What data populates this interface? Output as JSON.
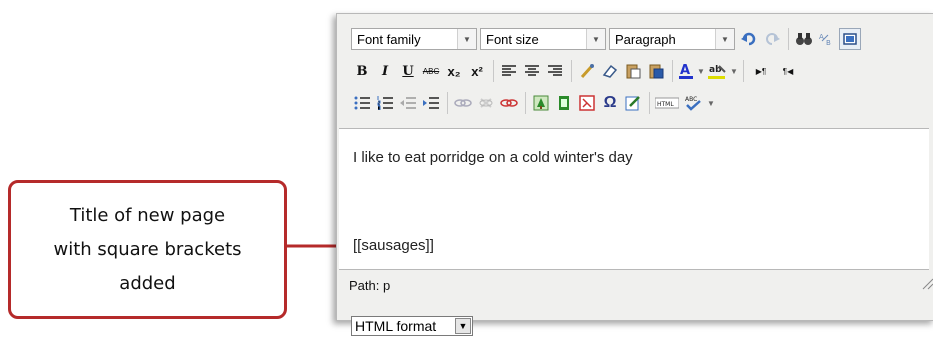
{
  "toolbar": {
    "font_family": "Font family",
    "font_size": "Font size",
    "paragraph": "Paragraph",
    "row2": [
      "B",
      "I",
      "U",
      "ABC",
      "x₂",
      "x²"
    ],
    "row2_extra": [
      "▶¶",
      "¶◀"
    ],
    "html_label": "HTML",
    "abc_label": "ABC",
    "omega": "Ω",
    "text_color_label": "A",
    "highlight_label": "ab"
  },
  "content": {
    "line1": "I like to eat porridge on a cold winter's day",
    "line2": "[[sausages]]"
  },
  "path": "Path: p",
  "format_select": "HTML format",
  "callout": {
    "text": "Title of new page\nwith square brackets\nadded"
  },
  "colors": {
    "callout_border": "#b52a2a",
    "arrow": "#b52a2a",
    "text_color": "#2233cc",
    "highlight": "#dddd00"
  }
}
